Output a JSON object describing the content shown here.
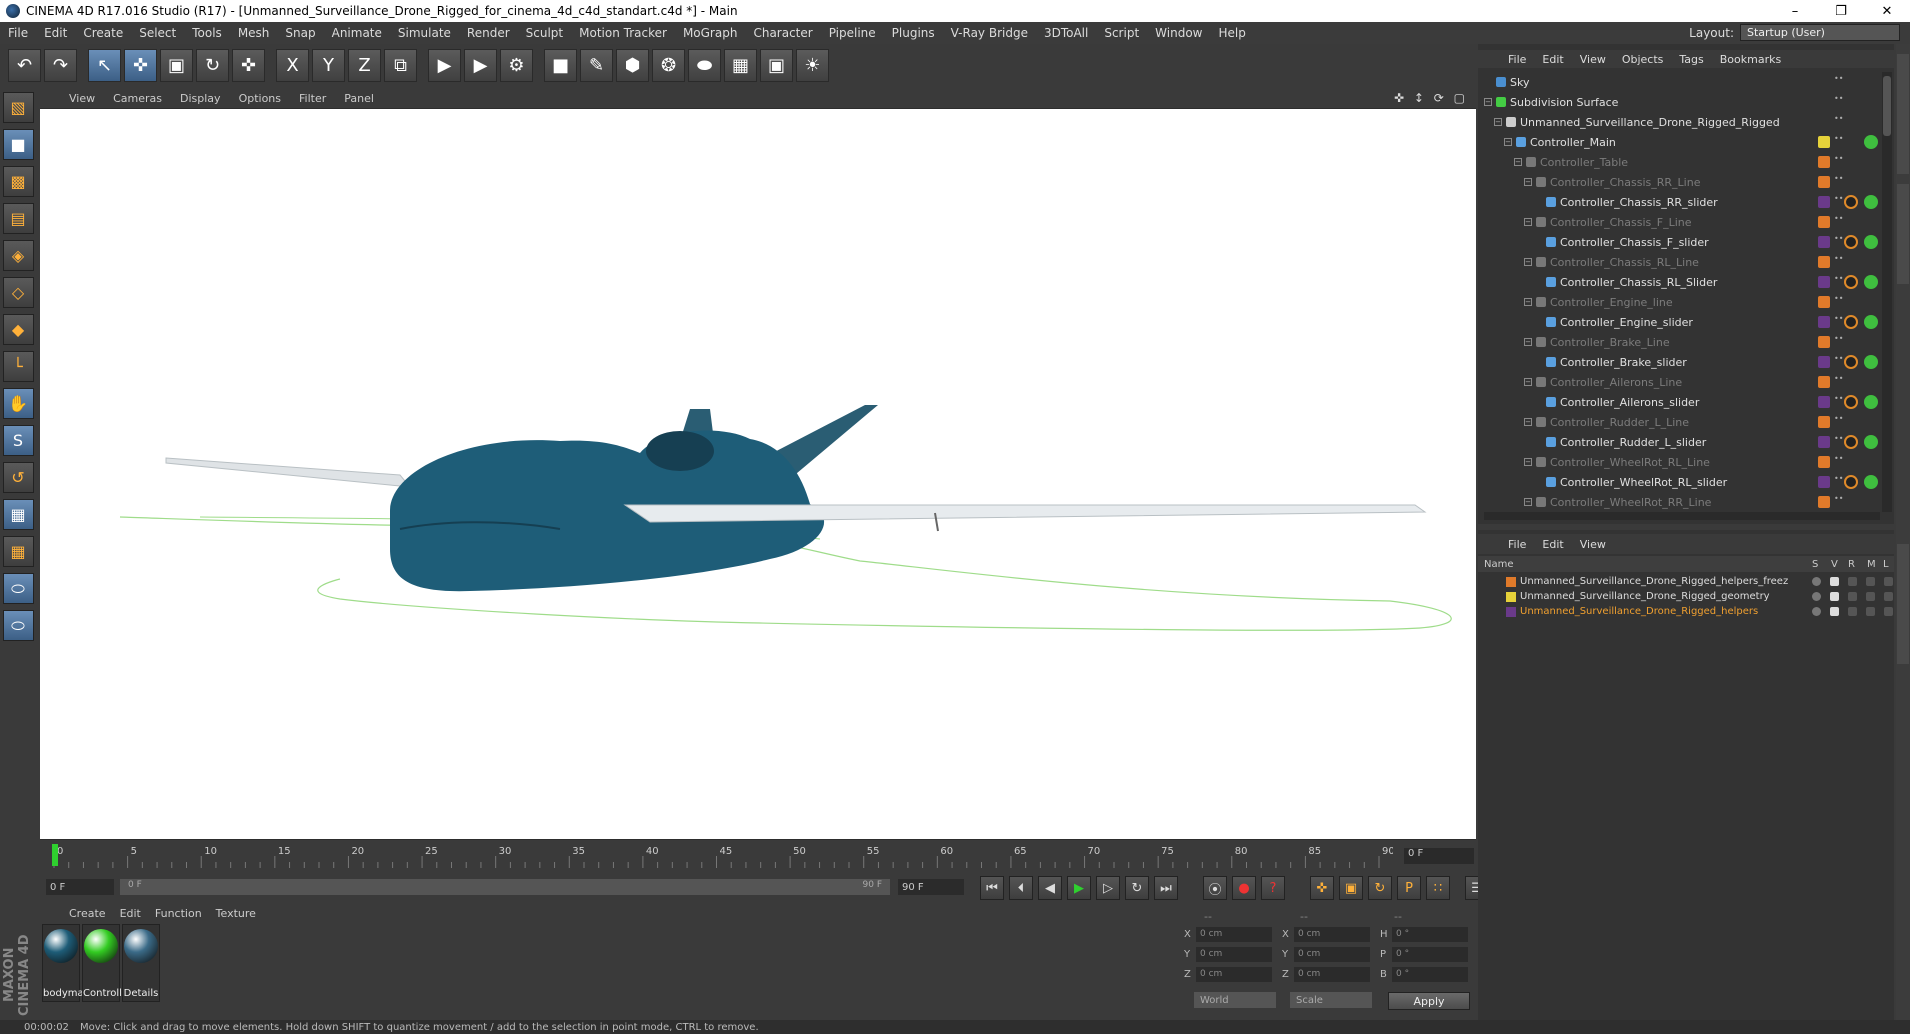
{
  "window": {
    "title": "CINEMA 4D R17.016 Studio (R17) - [Unmanned_Surveillance_Drone_Rigged_for_cinema_4d_c4d_standart.c4d *] - Main",
    "controls": [
      "–",
      "❐",
      "✕"
    ]
  },
  "menubar": {
    "items": [
      "File",
      "Edit",
      "Create",
      "Select",
      "Tools",
      "Mesh",
      "Snap",
      "Animate",
      "Simulate",
      "Render",
      "Sculpt",
      "Motion Tracker",
      "MoGraph",
      "Character",
      "Pipeline",
      "Plugins",
      "V-Ray Bridge",
      "3DToAll",
      "Script",
      "Window",
      "Help"
    ],
    "layout_label": "Layout:",
    "layout_value": "Startup (User)"
  },
  "toolbar": {
    "buttons": [
      {
        "name": "undo",
        "glyph": "↶"
      },
      {
        "name": "redo",
        "glyph": "↷"
      },
      {
        "name": "live-selection",
        "glyph": "↖"
      },
      {
        "name": "move",
        "glyph": "✜"
      },
      {
        "name": "scale",
        "glyph": "▣"
      },
      {
        "name": "rotate",
        "glyph": "↻"
      },
      {
        "name": "last-tool",
        "glyph": "✜"
      },
      {
        "name": "x-axis",
        "glyph": "X"
      },
      {
        "name": "y-axis",
        "glyph": "Y"
      },
      {
        "name": "z-axis",
        "glyph": "Z"
      },
      {
        "name": "coordinate-system",
        "glyph": "⧉"
      },
      {
        "name": "render-view",
        "glyph": "▶"
      },
      {
        "name": "render-picture-viewer",
        "glyph": "▶"
      },
      {
        "name": "edit-render-settings",
        "glyph": "⚙"
      },
      {
        "name": "cube",
        "glyph": "■"
      },
      {
        "name": "pen",
        "glyph": "✎"
      },
      {
        "name": "subdivision",
        "glyph": "⬢"
      },
      {
        "name": "cloner",
        "glyph": "❂"
      },
      {
        "name": "deformer",
        "glyph": "⬬"
      },
      {
        "name": "floor",
        "glyph": "▦"
      },
      {
        "name": "camera",
        "glyph": "▣"
      },
      {
        "name": "light",
        "glyph": "☀"
      }
    ]
  },
  "viewport": {
    "menu": [
      "View",
      "Cameras",
      "Display",
      "Options",
      "Filter",
      "Panel"
    ],
    "nav": "✜ ↕ ⟳ ▢"
  },
  "timeline": {
    "ticks": [
      "0",
      "5",
      "10",
      "15",
      "20",
      "25",
      "30",
      "35",
      "40",
      "45",
      "50",
      "55",
      "60",
      "65",
      "70",
      "75",
      "80",
      "85",
      "90"
    ],
    "current_frame": "0 F",
    "start_field": "0 F",
    "scrub_start": "0 F",
    "scrub_end": "90 F",
    "end_field": "90 F"
  },
  "transport": {
    "buttons": [
      "⏮",
      "⏴",
      "◀",
      "▶",
      "▷",
      "↻",
      "⏭",
      "⦿",
      "●",
      "?",
      "✜",
      "▣",
      "↻",
      "P",
      "∷",
      "☰"
    ]
  },
  "materials": {
    "menu": [
      "Create",
      "Edit",
      "Function",
      "Texture"
    ],
    "items": [
      {
        "label": "bodyma",
        "color": "#1e5d78"
      },
      {
        "label": "Controll",
        "color": "#33cc22"
      },
      {
        "label": "Details",
        "color": "#3b6b88"
      }
    ]
  },
  "coordinates": {
    "headers": [
      "--",
      "--",
      "--"
    ],
    "rows": [
      {
        "a": "X",
        "av": "0 cm",
        "b": "X",
        "bv": "0 cm",
        "c": "H",
        "cv": "0 °"
      },
      {
        "a": "Y",
        "av": "0 cm",
        "b": "Y",
        "bv": "0 cm",
        "c": "P",
        "cv": "0 °"
      },
      {
        "a": "Z",
        "av": "0 cm",
        "b": "Z",
        "bv": "0 cm",
        "c": "B",
        "cv": "0 °"
      }
    ],
    "mode": "World",
    "scale": "Scale",
    "apply": "Apply"
  },
  "status": {
    "time": "00:00:02",
    "message": "Move: Click and drag to move elements. Hold down SHIFT to quantize movement / add to the selection in point mode, CTRL to remove."
  },
  "object_manager": {
    "menu": [
      "File",
      "Edit",
      "View",
      "Objects",
      "Tags",
      "Bookmarks"
    ],
    "objects": [
      {
        "name": "Sky",
        "indent": 0,
        "dim": false,
        "icon": "#4a8fd0",
        "c1": null,
        "c2": null
      },
      {
        "name": "Subdivision Surface",
        "indent": 0,
        "dim": false,
        "icon": "#44cc44",
        "c1": null,
        "c2": null
      },
      {
        "name": "Unmanned_Surveillance_Drone_Rigged_Rigged",
        "indent": 1,
        "dim": false,
        "icon": "#cccccc",
        "c1": null,
        "c2": null
      },
      {
        "name": "Controller_Main",
        "indent": 2,
        "dim": false,
        "icon": "#5aa0e0",
        "c1": "#e6d23a",
        "c2": "#3fbf3f"
      },
      {
        "name": "Controller_Table",
        "indent": 3,
        "dim": true,
        "icon": "#777",
        "c1": "#e07a2a",
        "c2": null
      },
      {
        "name": "Controller_Chassis_RR_Line",
        "indent": 4,
        "dim": true,
        "icon": "#777",
        "c1": "#e07a2a",
        "c2": null
      },
      {
        "name": "Controller_Chassis_RR_slider",
        "indent": 5,
        "dim": false,
        "icon": "#5aa0e0",
        "c1": "#6a3a8a",
        "c2": "#3fbf3f"
      },
      {
        "name": "Controller_Chassis_F_Line",
        "indent": 4,
        "dim": true,
        "icon": "#777",
        "c1": "#e07a2a",
        "c2": null
      },
      {
        "name": "Controller_Chassis_F_slider",
        "indent": 5,
        "dim": false,
        "icon": "#5aa0e0",
        "c1": "#6a3a8a",
        "c2": "#3fbf3f"
      },
      {
        "name": "Controller_Chassis_RL_Line",
        "indent": 4,
        "dim": true,
        "icon": "#777",
        "c1": "#e07a2a",
        "c2": null
      },
      {
        "name": "Controller_Chassis_RL_Slider",
        "indent": 5,
        "dim": false,
        "icon": "#5aa0e0",
        "c1": "#6a3a8a",
        "c2": "#3fbf3f"
      },
      {
        "name": "Controller_Engine_line",
        "indent": 4,
        "dim": true,
        "icon": "#777",
        "c1": "#e07a2a",
        "c2": null
      },
      {
        "name": "Controller_Engine_slider",
        "indent": 5,
        "dim": false,
        "icon": "#5aa0e0",
        "c1": "#6a3a8a",
        "c2": "#3fbf3f"
      },
      {
        "name": "Controller_Brake_Line",
        "indent": 4,
        "dim": true,
        "icon": "#777",
        "c1": "#e07a2a",
        "c2": null
      },
      {
        "name": "Controller_Brake_slider",
        "indent": 5,
        "dim": false,
        "icon": "#5aa0e0",
        "c1": "#6a3a8a",
        "c2": "#3fbf3f"
      },
      {
        "name": "Controller_Ailerons_Line",
        "indent": 4,
        "dim": true,
        "icon": "#777",
        "c1": "#e07a2a",
        "c2": null
      },
      {
        "name": "Controller_Ailerons_slider",
        "indent": 5,
        "dim": false,
        "icon": "#5aa0e0",
        "c1": "#6a3a8a",
        "c2": "#3fbf3f"
      },
      {
        "name": "Controller_Rudder_L_Line",
        "indent": 4,
        "dim": true,
        "icon": "#777",
        "c1": "#e07a2a",
        "c2": null
      },
      {
        "name": "Controller_Rudder_L_slider",
        "indent": 5,
        "dim": false,
        "icon": "#5aa0e0",
        "c1": "#6a3a8a",
        "c2": "#3fbf3f"
      },
      {
        "name": "Controller_WheelRot_RL_Line",
        "indent": 4,
        "dim": true,
        "icon": "#777",
        "c1": "#e07a2a",
        "c2": null
      },
      {
        "name": "Controller_WheelRot_RL_slider",
        "indent": 5,
        "dim": false,
        "icon": "#5aa0e0",
        "c1": "#6a3a8a",
        "c2": "#3fbf3f"
      },
      {
        "name": "Controller_WheelRot_RR_Line",
        "indent": 4,
        "dim": true,
        "icon": "#777",
        "c1": "#e07a2a",
        "c2": null
      }
    ]
  },
  "layer_manager": {
    "menu": [
      "File",
      "Edit",
      "View"
    ],
    "headers": {
      "name": "Name",
      "s": "S",
      "v": "V",
      "r": "R",
      "m": "M",
      "l": "L"
    },
    "layers": [
      {
        "name": "Unmanned_Surveillance_Drone_Rigged_helpers_freez",
        "color": "#e07a2a",
        "highlight": false
      },
      {
        "name": "Unmanned_Surveillance_Drone_Rigged_geometry",
        "color": "#e6d23a",
        "highlight": false
      },
      {
        "name": "Unmanned_Surveillance_Drone_Rigged_helpers",
        "color": "#6a3a8a",
        "highlight": true
      }
    ]
  },
  "colors": {
    "accent": "#f0a030",
    "model": "#1e5d78",
    "selection_blue": "#4a7fb5"
  }
}
